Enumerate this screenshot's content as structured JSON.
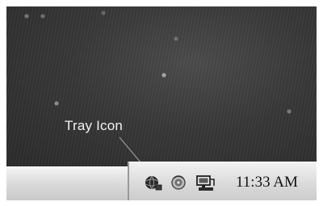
{
  "callout": {
    "label": "Tray Icon"
  },
  "tray": {
    "icons": [
      {
        "name": "network-globe-icon"
      },
      {
        "name": "volume-speaker-icon"
      },
      {
        "name": "monitor-computer-icon"
      }
    ],
    "clock": "11:33 AM"
  }
}
